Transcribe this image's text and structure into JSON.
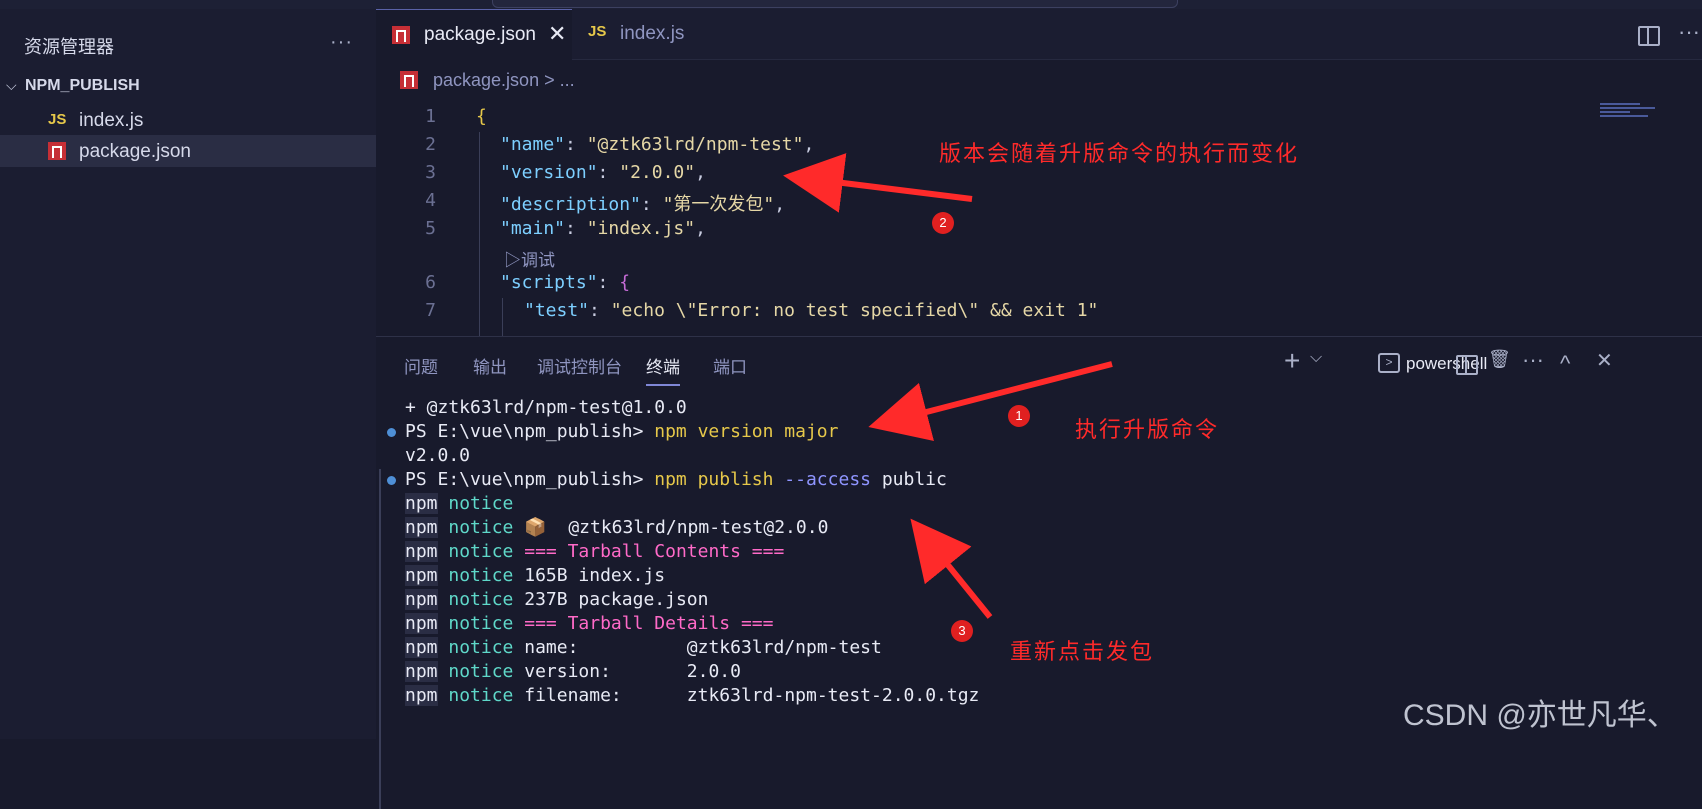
{
  "sidebar": {
    "title": "资源管理器",
    "more": "···",
    "folder": "NPM_PUBLISH",
    "files": [
      {
        "icon": "JS",
        "label": "index.js"
      },
      {
        "icon": "npm",
        "label": "package.json"
      }
    ]
  },
  "tabs": [
    {
      "label": "package.json",
      "close": "✕"
    },
    {
      "label": "index.js",
      "icon": "JS"
    }
  ],
  "breadcrumb": {
    "file": "package.json",
    "rest": " > ..."
  },
  "editor": {
    "line_numbers": [
      "1",
      "2",
      "3",
      "4",
      "5",
      "6",
      "7"
    ],
    "lines": {
      "l1": "{",
      "l2_key": "\"name\"",
      "l2_val": "\"@ztk63lrd/npm-test\"",
      "l3_key": "\"version\"",
      "l3_val": "\"2.0.0\"",
      "l4_key": "\"description\"",
      "l4_val": "\"第一次发包\"",
      "l5_key": "\"main\"",
      "l5_val": "\"index.js\"",
      "lens": "▷调试",
      "l6_key": "\"scripts\"",
      "l6_brace": "{",
      "l7_key": "\"test\"",
      "l7_val": "\"echo \\\"Error: no test specified\\\" && exit 1\""
    }
  },
  "panel": {
    "tabs": [
      "问题",
      "输出",
      "调试控制台",
      "终端",
      "端口"
    ],
    "shell": "powershell",
    "icons": {
      "plus": "+",
      "chevron": "⌵",
      "trash": "🗑",
      "more": "···",
      "up": "^",
      "close": "✕"
    }
  },
  "terminal": {
    "line1": "+ @ztk63lrd/npm-test@1.0.0",
    "prompt": "PS E:\\vue\\npm_publish> ",
    "cmd1": "npm version major",
    "line3": "v2.0.0",
    "cmd2_npm": "npm publish ",
    "cmd2_flag": "--access",
    "cmd2_rest": " public",
    "npm": "npm",
    "notice": "notice",
    "pkg": "📦  @ztk63lrd/npm-test@2.0.0",
    "tarball_contents": "=== Tarball Contents ===",
    "file1": "165B index.js",
    "file2": "237B package.json",
    "tarball_details": "=== Tarball Details ===",
    "name_row": "name:          @ztk63lrd/npm-test",
    "version_row": "version:       2.0.0",
    "filename_row": "filename:      ztk63lrd-npm-test-2.0.0.tgz"
  },
  "annotations": {
    "a1_text": "执行升版命令",
    "a2_text": "版本会随着升版命令的执行而变化",
    "a3_text": "重新点击发包",
    "badge1": "1",
    "badge2": "2",
    "badge3": "3",
    "color": "#ff2a2a"
  },
  "watermark": "CSDN @亦世凡华、"
}
